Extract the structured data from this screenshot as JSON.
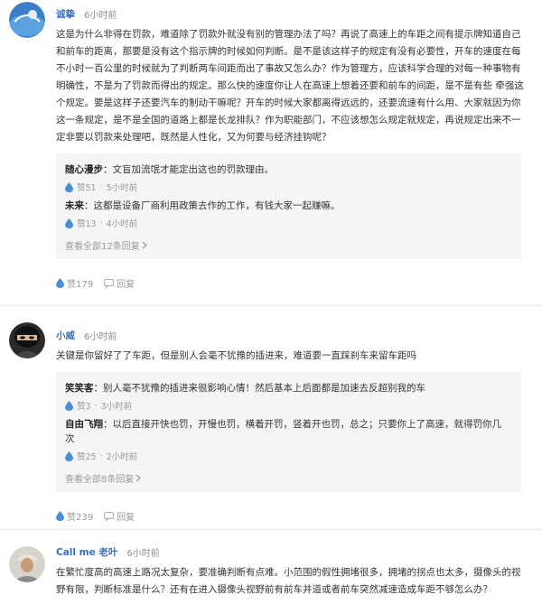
{
  "comments": [
    {
      "user": "诚挚",
      "time": "6小时前",
      "body": "这是为什么非得在罚款，难道除了罚款外就没有别的管理办法了吗？再说了高速上的车距之间有提示牌知道自己和前车的距离，那要是没有这个指示牌的时候如何判断。是不是该这样子的规定有没有必要性，开车的速度在每不小时一百公里的时候就为了判断两车间距而出了事故又怎么办？作为管理方，应该科学合理的对每一种事物有明确性，不是为了罚款而得出的规定。那么快的速度你让人在高速上想着还要和前车的间距，是不是有些 牵强这个规定。要是这样子还要汽车的制动干嘛呢？开车的时候大家都离得远远的，还要流速有什么用、大家就因为你这一条规定，是不是全国的道路上都是长龙排队？作为职能部门，不应该想怎么规定就规定，再说规定出来不一定非要以罚款来处理吧，既然是人性化，又为何要与经济挂钩呢？",
      "replies": [
        {
          "name": "随心漫步",
          "text": "文盲加流氓才能定出这也的罚款理由。",
          "likes": "赞51",
          "time": "5小时前"
        },
        {
          "name": "未来",
          "text": "这都是设备厂商利用政策去作的工作，有钱大家一起赚嘛。",
          "likes": "赞13",
          "time": "4小时前"
        }
      ],
      "more": "查看全部12条回复",
      "likes": "赞179",
      "reply_label": "回复"
    },
    {
      "user": "小威",
      "time": "6小时前",
      "body": "关键是你留好了了车距，但是别人会毫不犹豫的插进来，难道要一直踩刹车来留车距吗",
      "replies": [
        {
          "name": "笑笑客",
          "text": "别人毫不犹豫的插进来很影响心情！然后基本上后面都是加速去反超别我的车",
          "likes": "赞3",
          "time": "3小时前"
        },
        {
          "name": "自由飞翔",
          "text": "以后直接开快也罚，开慢也罚，横着开罚，竖着开也罚，总之；只要你上了高速，就得罚你几次",
          "likes": "赞25",
          "time": "2小时前"
        }
      ],
      "more": "查看全部8条回复",
      "likes": "赞239",
      "reply_label": "回复"
    },
    {
      "user": "Call me 老叶",
      "time": "6小时前",
      "body": "在繁忙度高的高速上路况太复杂，要准确判断有点难。小范围的假性拥堵很多，拥堵的拐点也太多，摄像头的视野有限，判断标准是什么？还有在进入摄像头视野前有前车并道或者前车突然减速造成车距不够怎么办？"
    }
  ],
  "colors": {
    "name": "#3a6fc4",
    "like_icon": "#4a8fd6",
    "muted": "#999999"
  },
  "icons": {
    "like": "water-drop-icon",
    "reply": "speech-bubble-icon"
  }
}
